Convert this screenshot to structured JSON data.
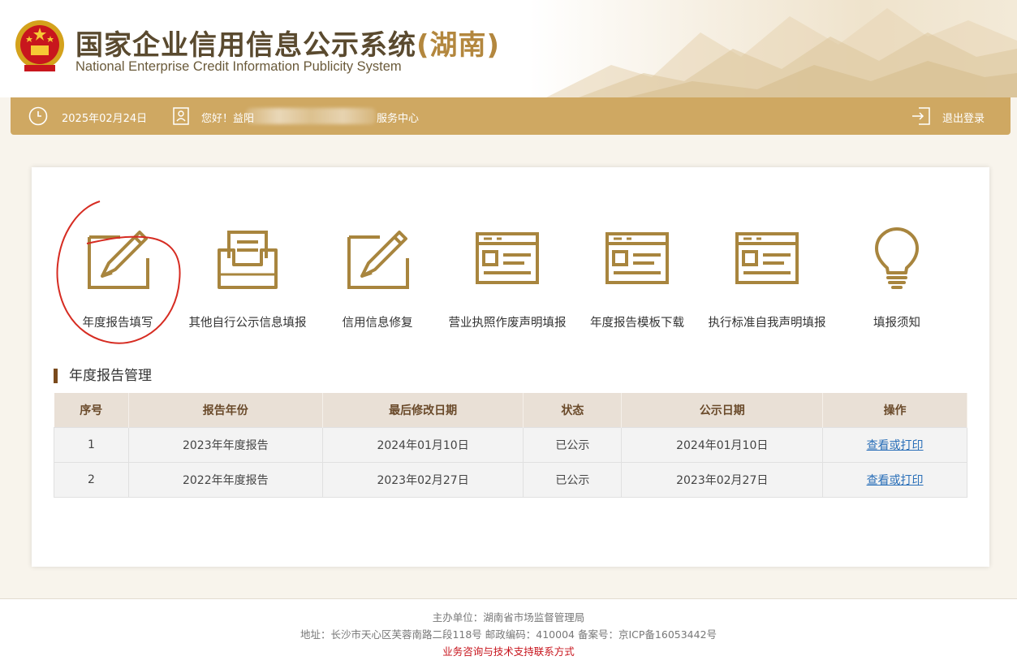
{
  "header": {
    "title_cn": "国家企业信用信息公示系统",
    "title_region": "(湖南)",
    "title_en": "National Enterprise Credit Information Publicity System"
  },
  "topbar": {
    "date": "2025年02月24日",
    "greeting": "您好！益阳",
    "center_suffix": "服务中心",
    "logout": "退出登录"
  },
  "menu": [
    {
      "label": "年度报告填写",
      "icon": "edit-pen-icon"
    },
    {
      "label": "其他自行公示信息填报",
      "icon": "document-tray-icon"
    },
    {
      "label": "信用信息修复",
      "icon": "edit-pen-icon"
    },
    {
      "label": "营业执照作废声明填报",
      "icon": "license-card-icon"
    },
    {
      "label": "年度报告模板下载",
      "icon": "license-card-icon"
    },
    {
      "label": "执行标准自我声明填报",
      "icon": "license-card-icon"
    },
    {
      "label": "填报须知",
      "icon": "lightbulb-icon"
    }
  ],
  "section_title": "年度报告管理",
  "table": {
    "headers": [
      "序号",
      "报告年份",
      "最后修改日期",
      "状态",
      "公示日期",
      "操作"
    ],
    "rows": [
      [
        "1",
        "2023年年度报告",
        "2024年01月10日",
        "已公示",
        "2024年01月10日",
        "查看或打印"
      ],
      [
        "2",
        "2022年年度报告",
        "2023年02月27日",
        "已公示",
        "2023年02月27日",
        "查看或打印"
      ]
    ]
  },
  "footer": {
    "sponsor": "主办单位：湖南省市场监督管理局",
    "address": "地址：长沙市天心区芙蓉南路二段118号 邮政编码：410004 备案号：京ICP备16053442号",
    "contact": "业务咨询与技术支持联系方式"
  },
  "colors": {
    "gold": "#cfa862",
    "icon_brown": "#a8853e",
    "link": "#2a6fb8",
    "footer_red": "#c7141c"
  }
}
